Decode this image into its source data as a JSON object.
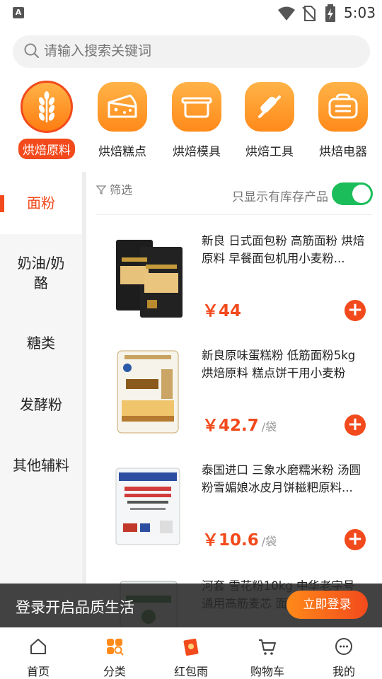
{
  "status_bar": {
    "time": "5:03",
    "notification_badge": "A"
  },
  "search": {
    "placeholder": "请输入搜索关键词"
  },
  "categories": [
    {
      "label": "烘焙原料",
      "icon": "wheat-icon",
      "active": true
    },
    {
      "label": "烘焙糕点",
      "icon": "cake-icon",
      "active": false
    },
    {
      "label": "烘焙模具",
      "icon": "mold-icon",
      "active": false
    },
    {
      "label": "烘焙工具",
      "icon": "rolling-pin-icon",
      "active": false
    },
    {
      "label": "烘焙电器",
      "icon": "toaster-icon",
      "active": false
    }
  ],
  "sidebar": {
    "items": [
      {
        "label": "面粉",
        "active": true
      },
      {
        "label": "奶油/奶酪",
        "active": false
      },
      {
        "label": "糖类",
        "active": false
      },
      {
        "label": "发酵粉",
        "active": false
      },
      {
        "label": "其他辅料",
        "active": false
      }
    ]
  },
  "filter": {
    "label": "筛选",
    "stock_only_label": "只显示有库存产品",
    "stock_only_on": true
  },
  "products": [
    {
      "title": "新良 日式面包粉 高筋面粉 烘焙原料 早餐面包机用小麦粉...",
      "price": "￥44",
      "unit": ""
    },
    {
      "title": "新良原味蛋糕粉 低筋面粉5kg 烘焙原料 糕点饼干用小麦粉",
      "price": "￥42.7",
      "unit": "/袋"
    },
    {
      "title": "泰国进口 三象水磨糯米粉 汤圆粉雪媚娘冰皮月饼糍粑原料...",
      "price": "￥10.6",
      "unit": "/袋"
    },
    {
      "title": "河套 雪花粉10kg 中华老字号 通用高筋麦芯 面粉...",
      "price": "",
      "unit": ""
    }
  ],
  "login_banner": {
    "text": "登录开启品质生活",
    "button": "立即登录"
  },
  "bottom_nav": [
    {
      "label": "首页",
      "icon": "home-icon"
    },
    {
      "label": "分类",
      "icon": "category-icon"
    },
    {
      "label": "红包雨",
      "icon": "red-envelope-icon"
    },
    {
      "label": "购物车",
      "icon": "cart-icon"
    },
    {
      "label": "我的",
      "icon": "profile-icon"
    }
  ],
  "colors": {
    "accent": "#f24a1c",
    "orange": "#ff8a1a",
    "toggle_on": "#1bbd5a"
  }
}
